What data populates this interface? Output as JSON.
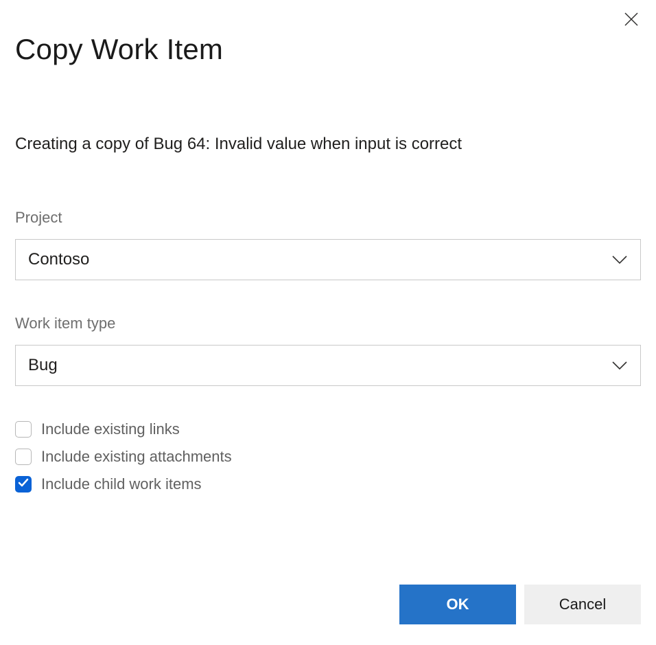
{
  "dialog": {
    "title": "Copy Work Item",
    "description": "Creating a copy of Bug 64: Invalid value when input is correct"
  },
  "fields": {
    "project": {
      "label": "Project",
      "value": "Contoso"
    },
    "workItemType": {
      "label": "Work item type",
      "value": "Bug"
    }
  },
  "checkboxes": {
    "includeLinks": {
      "label": "Include existing links",
      "checked": false
    },
    "includeAttachments": {
      "label": "Include existing attachments",
      "checked": false
    },
    "includeChildren": {
      "label": "Include child work items",
      "checked": true
    }
  },
  "buttons": {
    "ok": "OK",
    "cancel": "Cancel"
  }
}
